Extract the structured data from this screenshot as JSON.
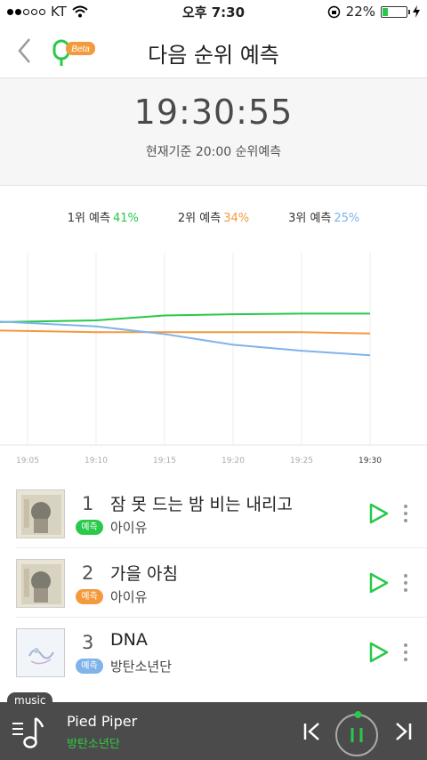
{
  "status": {
    "carrier": "KT",
    "time": "오후 7:30",
    "battery": "22%"
  },
  "header": {
    "title": "다음 순위 예측",
    "beta": "Beta"
  },
  "timer": {
    "time": "19:30:55",
    "subtitle": "현재기준 20:00 순위예측"
  },
  "legend": [
    {
      "label": "1위 예측",
      "value": "41%",
      "color": "#2ac84b"
    },
    {
      "label": "2위 예측",
      "value": "34%",
      "color": "#f39a3c"
    },
    {
      "label": "3위 예측",
      "value": "25%",
      "color": "#7fb3ea"
    }
  ],
  "chart_data": {
    "type": "line",
    "x": [
      "19:05",
      "19:10",
      "19:15",
      "19:20",
      "19:25",
      "19:30"
    ],
    "series": [
      {
        "name": "1위 예측",
        "color": "#2ac84b",
        "values": [
          38.5,
          38.9,
          40.4,
          40.8,
          41.0,
          41.0
        ]
      },
      {
        "name": "2위 예측",
        "color": "#f39a3c",
        "values": [
          35.6,
          35.2,
          35.2,
          35.2,
          35.2,
          34.8
        ]
      },
      {
        "name": "3위 예측",
        "color": "#7fb3ea",
        "values": [
          38.1,
          37.0,
          34.6,
          31.3,
          29.4,
          28.0
        ]
      }
    ],
    "ylim": [
      0,
      60
    ],
    "grid": true
  },
  "ranking": [
    {
      "rank": "1",
      "title": "잠 못 드는 밤 비는 내리고",
      "badge": "예측",
      "badge_color": "#2ac84b",
      "artist": "아이유"
    },
    {
      "rank": "2",
      "title": "가을 아침",
      "badge": "예측",
      "badge_color": "#f39a3c",
      "artist": "아이유"
    },
    {
      "rank": "3",
      "title": "DNA",
      "badge": "예측",
      "badge_color": "#7fb3ea",
      "artist": "방탄소년단"
    }
  ],
  "player": {
    "tab": "music",
    "title": "Pied Piper",
    "artist": "방탄소년단",
    "progress": 0.01
  }
}
